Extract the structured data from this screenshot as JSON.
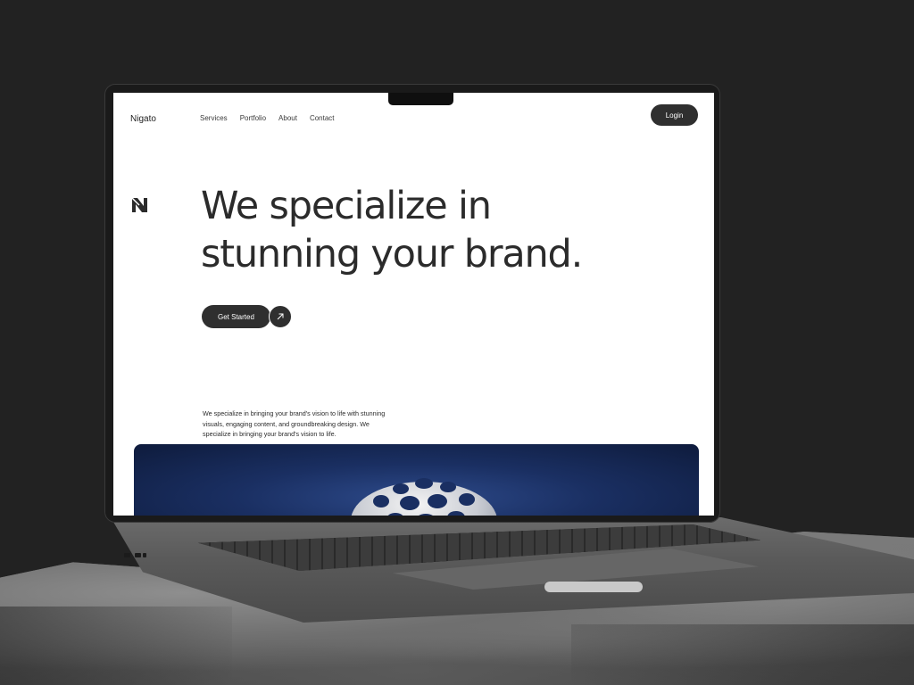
{
  "site": {
    "brand": "Nigato",
    "nav": [
      "Services",
      "Portfolio",
      "About",
      "Contact"
    ],
    "login_label": "Login"
  },
  "hero": {
    "title_line1": "We specialize in",
    "title_line2": "stunning your brand.",
    "cta_label": "Get Started",
    "blurb": "We specialize in bringing your brand's vision to life with stunning visuals, engaging content, and groundbreaking design. We specialize in bringing your brand's vision to life."
  },
  "icons": {
    "logo": "n-logo-icon",
    "cta_arrow": "arrow-up-right-icon"
  },
  "colors": {
    "background": "#222222",
    "accent_dark": "#2f2f2f",
    "screen_bg": "#ffffff",
    "media_blue": "#1a2f62"
  }
}
